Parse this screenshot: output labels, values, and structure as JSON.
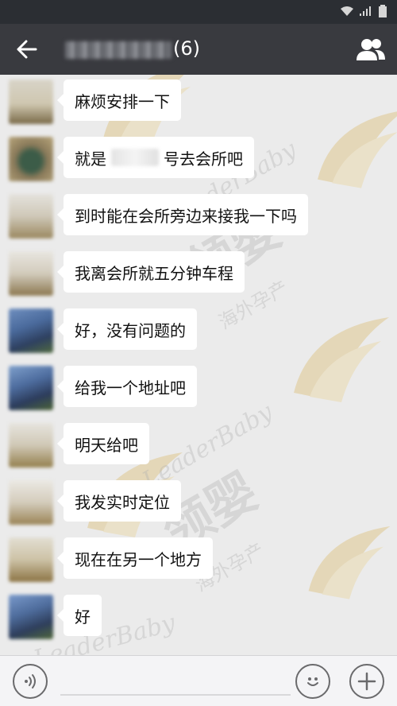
{
  "header": {
    "member_count": "(6)",
    "back_icon": "back-arrow-icon",
    "members_icon": "group-members-icon"
  },
  "status_bar": {
    "icons": [
      "wifi-icon",
      "signal-icon",
      "battery-icon"
    ]
  },
  "messages": [
    {
      "text": "麻烦安排一下"
    },
    {
      "text_before": "就是",
      "text_after": "号去会所吧"
    },
    {
      "text": "到时能在会所旁边来接我一下吗"
    },
    {
      "text": "我离会所就五分钟车程"
    },
    {
      "text": "好，没有问题的"
    },
    {
      "text": "给我一个地址吧"
    },
    {
      "text": "明天给吧"
    },
    {
      "text": "我发实时定位"
    },
    {
      "text": "现在在另一个地方"
    },
    {
      "text": "好"
    }
  ],
  "watermark": {
    "brand_en": "LeaderBaby",
    "brand_cn": "领婴",
    "tagline": "海外孕产"
  },
  "input_bar": {
    "icons": [
      "voice-icon",
      "emoji-icon",
      "plus-icon"
    ]
  },
  "colors": {
    "title_bar": "#393a3f",
    "status_bar": "#2b2e33",
    "chat_bg": "#ebebeb",
    "bubble": "#ffffff",
    "watermark": "#d9b45a"
  }
}
